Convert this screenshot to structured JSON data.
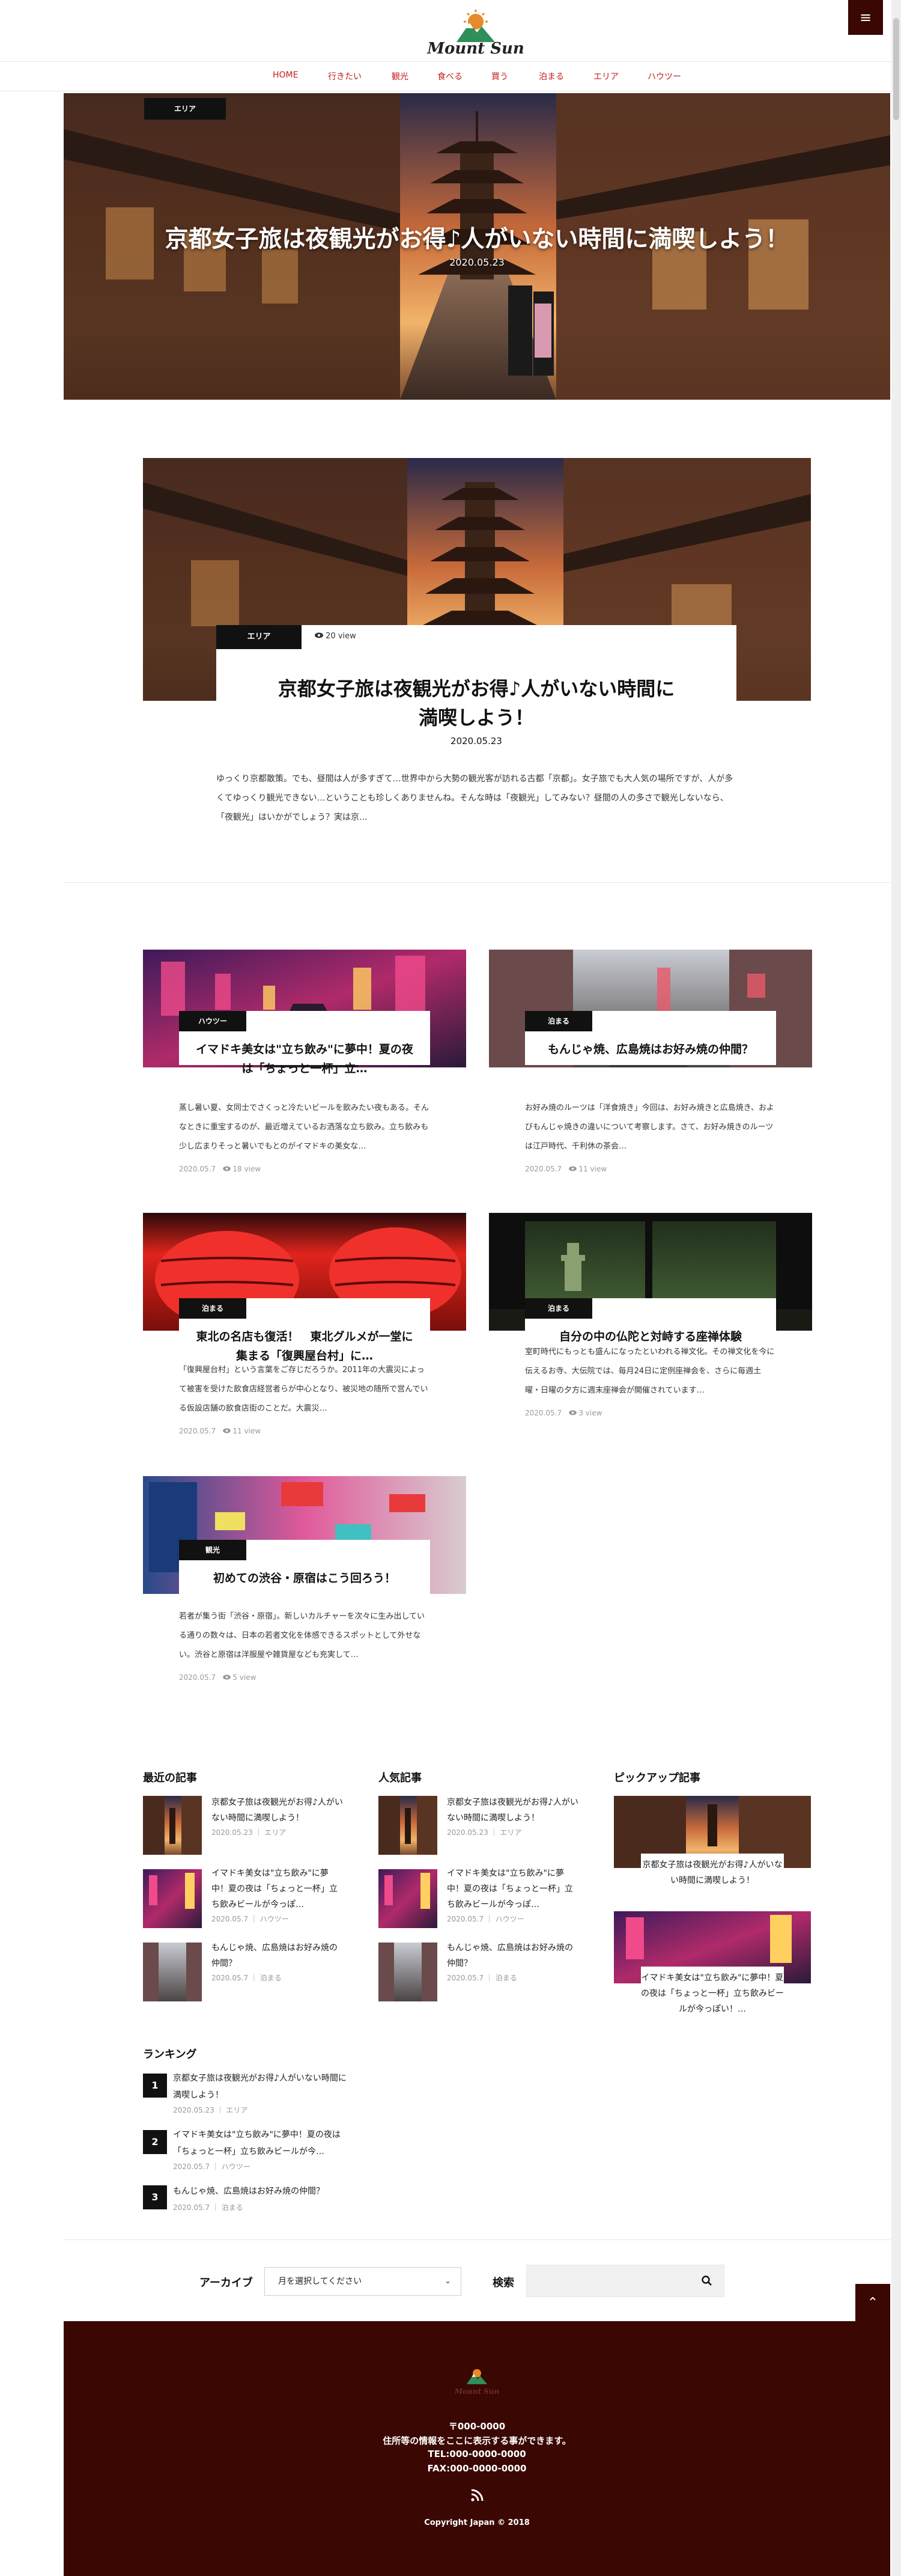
{
  "header": {
    "logo_text": "Mount Sun",
    "menu_icon": "hamburger-menu-icon",
    "accent_color": "#3a0702",
    "nav_color": "#c2201d"
  },
  "nav": {
    "items": [
      {
        "label": "HOME"
      },
      {
        "label": "行きたい"
      },
      {
        "label": "観光"
      },
      {
        "label": "食べる"
      },
      {
        "label": "買う"
      },
      {
        "label": "泊まる"
      },
      {
        "label": "エリア"
      },
      {
        "label": "ハウツー"
      }
    ]
  },
  "hero": {
    "category": "エリア",
    "title": "京都女子旅は夜観光がお得♪人がいない時間に満喫しよう！",
    "date": "2020.05.23"
  },
  "feature": {
    "category": "エリア",
    "views": "20 view",
    "title": "京都女子旅は夜観光がお得♪人がいない時間に満喫しよう！",
    "date": "2020.05.23",
    "excerpt": "ゆっくり京都散策。でも、昼間は人が多すぎて…世界中から大勢の観光客が訪れる古都「京都」。女子旅でも大人気の場所ですが、人が多くてゆっくり観光できない…ということも珍しくありませんね。そんな時は「夜観光」してみない？昼間の人の多さで観光しないなら、「夜観光」はいかがでしょう？実は京..."
  },
  "posts": [
    {
      "category": "ハウツー",
      "title": "イマドキ美女は\"立ち飲み\"に夢中！夏の夜は「ちょっと一杯」立…",
      "excerpt": "蒸し暑い夏、女同士でさくっと冷たいビールを飲みたい夜もある。そんなときに重宝するのが、最近増えているお洒落な立ち飲み。立ち飲みも少し広まりそっと暑いでもとのがイマドキの美女な…",
      "date": "2020.05.7",
      "views": "18 view"
    },
    {
      "category": "泊まる",
      "title": "もんじゃ焼、広島焼はお好み焼の仲間？",
      "excerpt": "お好み焼のルーツは「洋食焼き」今回は、お好み焼きと広島焼き、およびもんじゃ焼きの違いについて考察します。さて、お好み焼きのルーツは江戸時代、千利休の茶会…",
      "date": "2020.05.7",
      "views": "11 view"
    },
    {
      "category": "泊まる",
      "title": "東北の名店も復活！　東北グルメが一堂に集まる「復興屋台村」に…",
      "excerpt": "「復興屋台村」という言葉をご存じだろうか。2011年の大震災によって被害を受けた飲食店経営者らが中心となり、被災地の随所で営んでいる仮設店舗の飲食店街のことだ。大震災…",
      "date": "2020.05.7",
      "views": "11 view"
    },
    {
      "category": "泊まる",
      "title": "自分の中の仏陀と対峙する座禅体験",
      "excerpt": "室町時代にもっとも盛んになったといわれる禅文化。その禅文化を今に伝えるお寺、大伝院では、毎月24日に定例座禅会を、さらに毎週土曜・日曜の夕方に週末座禅会が開催されています…",
      "date": "2020.05.7",
      "views": "3 view"
    },
    {
      "category": "観光",
      "title": "初めての渋谷・原宿はこう回ろう！",
      "excerpt": "若者が集う街「渋谷・原宿」。新しいカルチャーを次々に生み出している通りの数々は、日本の若者文化を体感できるスポットとして外せない。渋谷と原宿は洋服屋や雑貨屋なども充実して…",
      "date": "2020.05.7",
      "views": "5 view"
    }
  ],
  "widgets": {
    "recent": {
      "heading": "最近の記事",
      "items": [
        {
          "title": "京都女子旅は夜観光がお得♪人がいない時間に満喫しよう！",
          "date": "2020.05.23",
          "category": "エリア"
        },
        {
          "title": "イマドキ美女は\"立ち飲み\"に夢中！夏の夜は「ちょっと一杯」立ち飲みビールが今っぽ…",
          "date": "2020.05.7",
          "category": "ハウツー"
        },
        {
          "title": "もんじゃ焼、広島焼はお好み焼の仲間？",
          "date": "2020.05.7",
          "category": "泊まる"
        }
      ]
    },
    "popular": {
      "heading": "人気記事",
      "items": [
        {
          "title": "京都女子旅は夜観光がお得♪人がいない時間に満喫しよう！",
          "date": "2020.05.23",
          "category": "エリア"
        },
        {
          "title": "イマドキ美女は\"立ち飲み\"に夢中！夏の夜は「ちょっと一杯」立ち飲みビールが今っぽ…",
          "date": "2020.05.7",
          "category": "ハウツー"
        },
        {
          "title": "もんじゃ焼、広島焼はお好み焼の仲間？",
          "date": "2020.05.7",
          "category": "泊まる"
        }
      ]
    },
    "pickup": {
      "heading": "ピックアップ記事",
      "items": [
        {
          "title": "京都女子旅は夜観光がお得♪人がいない時間に満喫しよう！"
        },
        {
          "title": "イマドキ美女は\"立ち飲み\"に夢中！夏の夜は「ちょっと一杯」立ち飲みビールが今っぽい！…"
        }
      ]
    },
    "ranking": {
      "heading": "ランキング",
      "items": [
        {
          "rank": "1",
          "title": "京都女子旅は夜観光がお得♪人がいない時間に満喫しよう！",
          "date": "2020.05.23",
          "category": "エリア"
        },
        {
          "rank": "2",
          "title": "イマドキ美女は\"立ち飲み\"に夢中！夏の夜は「ちょっと一杯」立ち飲みビールが今…",
          "date": "2020.05.7",
          "category": "ハウツー"
        },
        {
          "rank": "3",
          "title": "もんじゃ焼、広島焼はお好み焼の仲間？",
          "date": "2020.05.7",
          "category": "泊まる"
        }
      ]
    }
  },
  "archive": {
    "label": "アーカイブ",
    "select_value": "月を選択してください"
  },
  "search": {
    "label": "検索",
    "placeholder": ""
  },
  "footer": {
    "logo_text": "Mount Sun",
    "postal": "〒000-0000",
    "address": "住所等の情報をここに表示する事ができます。",
    "tel": "TEL:000-0000-0000",
    "fax": "FAX:000-0000-0000",
    "copyright": "Copyright Japan © 2018"
  }
}
